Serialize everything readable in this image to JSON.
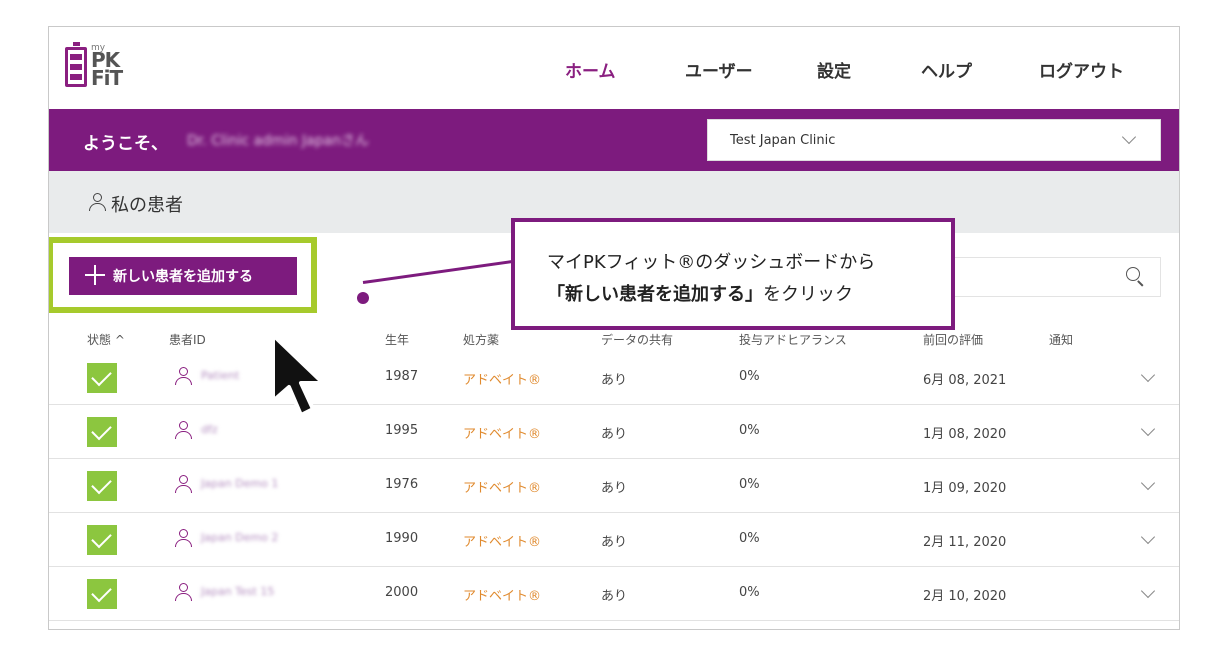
{
  "logo": {
    "my": "my",
    "pk": "PK",
    "fit": "FiT"
  },
  "nav": [
    {
      "label": "ホーム",
      "active": true
    },
    {
      "label": "ユーザー"
    },
    {
      "label": "設定"
    },
    {
      "label": "ヘルプ"
    },
    {
      "label": "ログアウト"
    }
  ],
  "welcome": {
    "prefix": "ようこそ、",
    "name": "Dr. Clinic admin Japanさん"
  },
  "clinic_select": {
    "value": "Test Japan Clinic"
  },
  "patients": {
    "title": "私の患者",
    "add_button": "新しい患者を追加する"
  },
  "table": {
    "headers": [
      "状態 ^",
      "患者ID",
      "生年",
      "処方薬",
      "データの共有",
      "投与アドヒアランス",
      "前回の評価",
      "通知"
    ],
    "rows": [
      {
        "id": "Patient",
        "year": "1987",
        "drug": "アドベイト®",
        "share": "あり",
        "adherence": "0%",
        "last": "6月 08, 2021"
      },
      {
        "id": "dfz",
        "year": "1995",
        "drug": "アドベイト®",
        "share": "あり",
        "adherence": "0%",
        "last": "1月 08, 2020"
      },
      {
        "id": "Japan Demo 1",
        "year": "1976",
        "drug": "アドベイト®",
        "share": "あり",
        "adherence": "0%",
        "last": "1月 09, 2020"
      },
      {
        "id": "Japan Demo 2",
        "year": "1990",
        "drug": "アドベイト®",
        "share": "あり",
        "adherence": "0%",
        "last": "2月 11, 2020"
      },
      {
        "id": "Japan Test 15",
        "year": "2000",
        "drug": "アドベイト®",
        "share": "あり",
        "adherence": "0%",
        "last": "2月 10, 2020"
      }
    ]
  },
  "callout": {
    "line1": "マイPKフィット®のダッシュボードから",
    "line2_bold": "「新しい患者を追加する」",
    "line2_rest": "をクリック"
  },
  "colors": {
    "brand_purple": "#7d1b7e",
    "highlight_green": "#a6ca2c",
    "status_green": "#8cc63f",
    "drug_orange": "#e08a2e"
  }
}
